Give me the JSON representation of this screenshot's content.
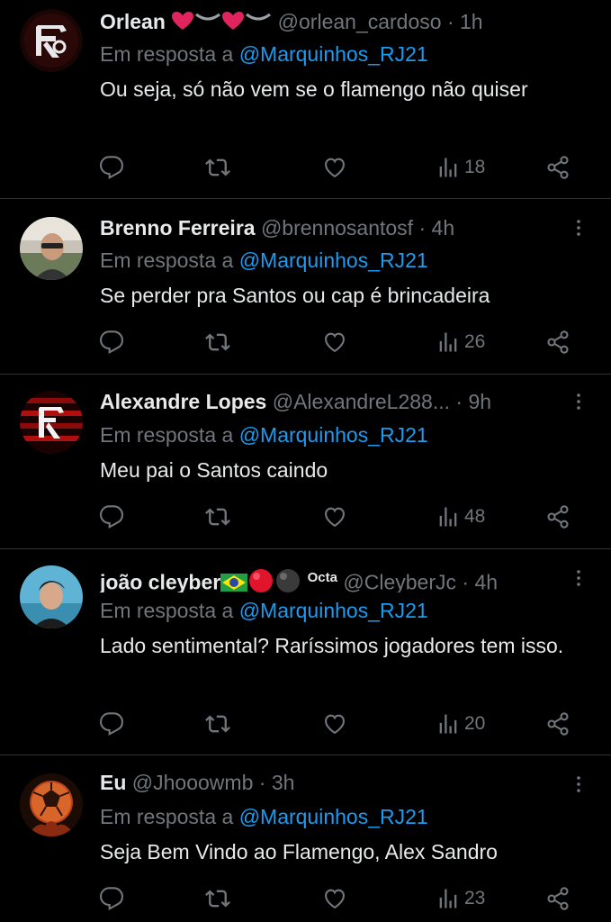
{
  "tweets": [
    {
      "name": "Orlean",
      "handle": "@orlean_cardoso",
      "time": "1h",
      "reply_label": "Em resposta a",
      "mention": "@Marquinhos_RJ21",
      "text": "Ou seja, só não vem se o flamengo não quiser",
      "views": "18",
      "avatar": "flamengo-crest"
    },
    {
      "name": "Brenno Ferreira",
      "handle": "@brennosantosf",
      "time": "4h",
      "reply_label": "Em resposta a",
      "mention": "@Marquinhos_RJ21",
      "text": "Se perder pra Santos ou cap é brincadeira",
      "views": "26",
      "avatar": "person-photo"
    },
    {
      "name": "Alexandre Lopes",
      "handle": "@AlexandreL288...",
      "time": "9h",
      "reply_label": "Em resposta a",
      "mention": "@Marquinhos_RJ21",
      "text": "Meu pai o Santos caindo",
      "views": "48",
      "avatar": "flamengo-crest"
    },
    {
      "name": "joão cleyber",
      "name_suffix": "Octa",
      "handle": "@CleyberJc",
      "time": "4h",
      "reply_label": "Em resposta a",
      "mention": "@Marquinhos_RJ21",
      "text": "Lado sentimental? Raríssimos jogadores tem isso.",
      "views": "20",
      "avatar": "person-photo"
    },
    {
      "name": "Eu",
      "handle": "@Jhooowmb",
      "time": "3h",
      "reply_label": "Em resposta a",
      "mention": "@Marquinhos_RJ21",
      "text": "Seja Bem Vindo ao Flamengo, Alex Sandro",
      "views": "23",
      "avatar": "soccer-ball"
    }
  ],
  "separator": "·",
  "colors": {
    "background": "#000000",
    "text": "#e7e9ea",
    "muted": "#71767b",
    "link": "#1d9bf0",
    "border": "#2f3336"
  },
  "icons": [
    "reply-icon",
    "retweet-icon",
    "like-icon",
    "views-icon",
    "share-icon",
    "more-icon"
  ]
}
